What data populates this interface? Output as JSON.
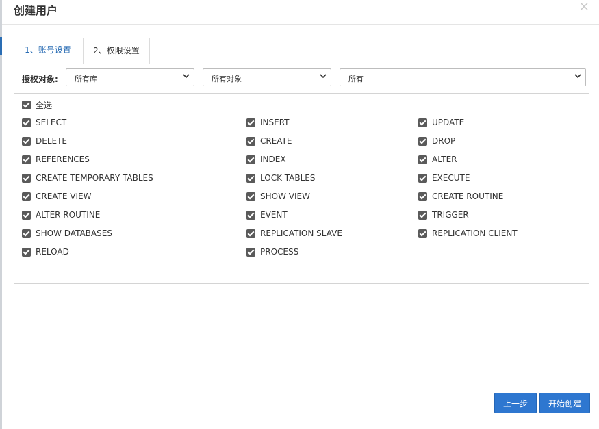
{
  "dialog": {
    "title": "创建用户",
    "close": "×"
  },
  "tabs": [
    {
      "label": "1、账号设置",
      "active": false
    },
    {
      "label": "2、权限设置",
      "active": true
    }
  ],
  "filters": {
    "label": "授权对象:",
    "database": "所有库",
    "object": "所有对象",
    "scope": "所有"
  },
  "permissions": {
    "select_all": {
      "label": "全选",
      "checked": true
    },
    "items": [
      {
        "label": "SELECT",
        "checked": true
      },
      {
        "label": "INSERT",
        "checked": true
      },
      {
        "label": "UPDATE",
        "checked": true
      },
      {
        "label": "DELETE",
        "checked": true
      },
      {
        "label": "CREATE",
        "checked": true
      },
      {
        "label": "DROP",
        "checked": true
      },
      {
        "label": "REFERENCES",
        "checked": true
      },
      {
        "label": "INDEX",
        "checked": true
      },
      {
        "label": "ALTER",
        "checked": true
      },
      {
        "label": "CREATE TEMPORARY TABLES",
        "checked": true
      },
      {
        "label": "LOCK TABLES",
        "checked": true
      },
      {
        "label": "EXECUTE",
        "checked": true
      },
      {
        "label": "CREATE VIEW",
        "checked": true
      },
      {
        "label": "SHOW VIEW",
        "checked": true
      },
      {
        "label": "CREATE ROUTINE",
        "checked": true
      },
      {
        "label": "ALTER ROUTINE",
        "checked": true
      },
      {
        "label": "EVENT",
        "checked": true
      },
      {
        "label": "TRIGGER",
        "checked": true
      },
      {
        "label": "SHOW DATABASES",
        "checked": true
      },
      {
        "label": "REPLICATION SLAVE",
        "checked": true
      },
      {
        "label": "REPLICATION CLIENT",
        "checked": true
      },
      {
        "label": "RELOAD",
        "checked": true
      },
      {
        "label": "PROCESS",
        "checked": true
      }
    ]
  },
  "buttons": {
    "prev": "上一步",
    "create": "开始创建"
  }
}
